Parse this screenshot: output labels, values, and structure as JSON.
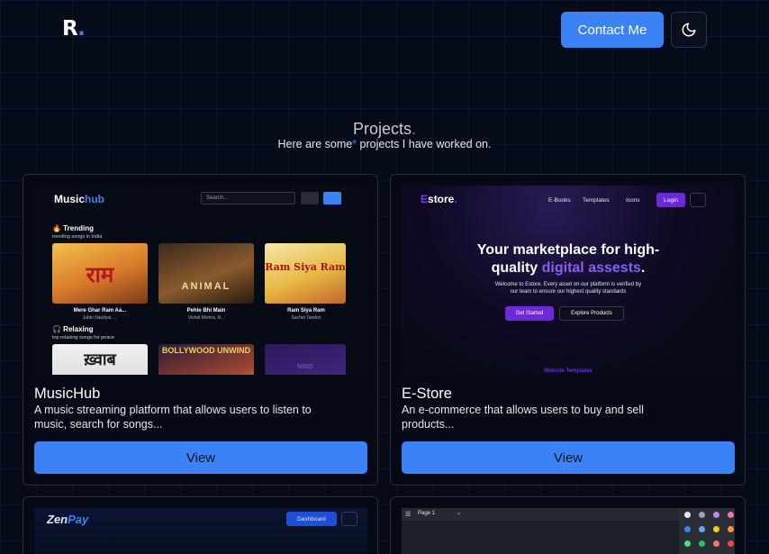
{
  "header": {
    "logo_letter": "R",
    "logo_dot": ".",
    "contact_label": "Contact Me",
    "theme_icon": "moon-icon"
  },
  "projects": {
    "title": "Projects",
    "title_dot": ".",
    "subtitle_pre": "Here are some",
    "subtitle_star": "*",
    "subtitle_post": " projects I have worked on."
  },
  "cards": [
    {
      "title": "MusicHub",
      "description": "A music streaming platform that allows users to listen to music, search for songs...",
      "view_label": "View",
      "preview": {
        "logo_a": "Music",
        "logo_b": "hub",
        "search_placeholder": "Search...",
        "trending_title": "🔥 Trending",
        "trending_sub": "trending songs in India",
        "relaxing_title": "🎧 Relaxing",
        "relaxing_sub": "top relaxing songs for peace",
        "trending_tiles": [
          {
            "art": "राम",
            "name": "Mere Ghar Ram Aa...",
            "artist": "Jubin Nautiyal, ..."
          },
          {
            "art": "ANIMAL",
            "name": "Pehle Bhi Main",
            "artist": "Vishal Mishra, R..."
          },
          {
            "art": "Ram Siya Ram",
            "name": "Ram Siya Ram",
            "artist": "Sachet Tandon"
          }
        ],
        "relaxing_tiles": [
          {
            "art": "ख़्वाब"
          },
          {
            "art": "BOLLYWOOD UNWIND"
          },
          {
            "art": "MIND"
          }
        ]
      }
    },
    {
      "title": "E-Store",
      "description": "An e-commerce that allows users to buy and sell products...",
      "view_label": "View",
      "preview": {
        "logo_first": "E",
        "logo_rest": "store",
        "logo_dot": ".",
        "nav": [
          "E-Books",
          "Templates",
          "Icons"
        ],
        "login_label": "Login",
        "headline_line1": "Your marketplace for high-",
        "headline_plain": "quality ",
        "headline_accent": "digital assests",
        "headline_end": ".",
        "tagline_line1": "Welcome to Estore. Every asset on our platform is verified by",
        "tagline_line2": "our team to ensure our highest quality standards",
        "primary_label": "Get Started",
        "secondary_label": "Explore Products",
        "footer_text": "Website Templates"
      }
    },
    {
      "preview": {
        "logo_a": "Zen",
        "logo_b": "Pay",
        "dashboard_label": "Dashboard"
      }
    },
    {
      "preview": {
        "page_label": "Page 1"
      }
    }
  ],
  "colors": {
    "accent": "#3b82f6",
    "background": "#060b1a",
    "estore_purple": "#6d28d9"
  }
}
